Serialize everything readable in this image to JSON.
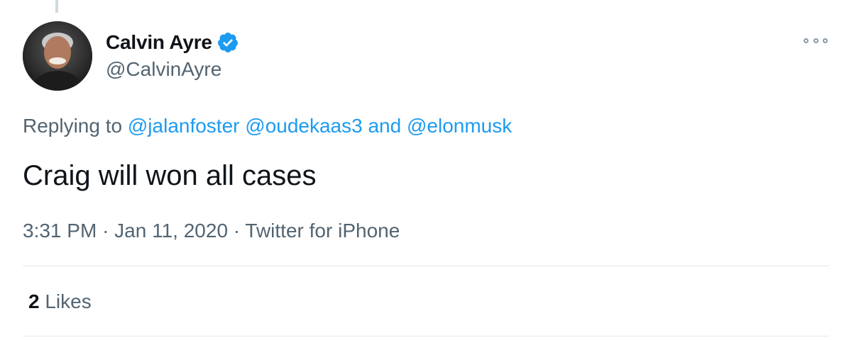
{
  "author": {
    "display_name": "Calvin Ayre",
    "handle": "@CalvinAyre",
    "verified": true,
    "verified_icon": "verified-badge-icon",
    "verified_color": "#1d9bf0"
  },
  "more_icon": "more-options-icon",
  "reply": {
    "prefix": "Replying to",
    "mention_1": "@jalanfoster",
    "mention_2": "@oudekaas3",
    "conjunction": "and",
    "mention_3": "@elonmusk"
  },
  "tweet_text": "Craig will won all cases",
  "meta": {
    "time": "3:31 PM",
    "separator": "·",
    "date": "Jan 11, 2020",
    "source": "Twitter for iPhone"
  },
  "stats": {
    "likes_count": "2",
    "likes_label": "Likes"
  },
  "colors": {
    "link": "#1d9bf0",
    "secondary_text": "#536471",
    "primary_text": "#0f1419"
  }
}
